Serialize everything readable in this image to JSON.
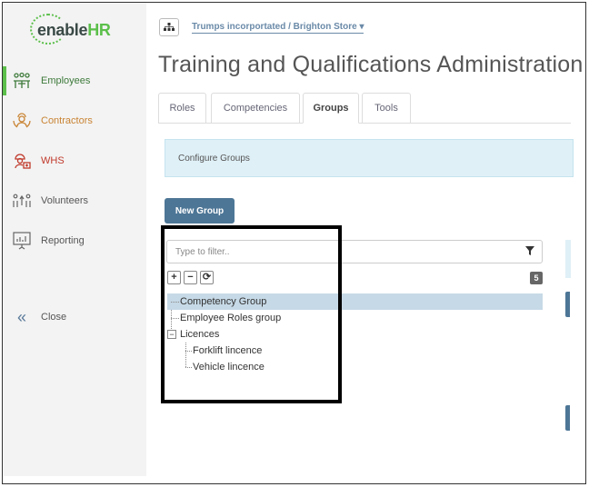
{
  "brand": {
    "part1": "enable",
    "part2": "HR"
  },
  "sidebar": {
    "items": [
      {
        "label": "Employees",
        "icon": "employees-icon",
        "color": "#3d7a3a",
        "active": true
      },
      {
        "label": "Contractors",
        "icon": "contractors-icon",
        "color": "#c98434"
      },
      {
        "label": "WHS",
        "icon": "whs-icon",
        "color": "#c0392b"
      },
      {
        "label": "Volunteers",
        "icon": "volunteers-icon",
        "color": "#555555"
      },
      {
        "label": "Reporting",
        "icon": "reporting-icon",
        "color": "#555555"
      }
    ],
    "close_label": "Close"
  },
  "breadcrumb": {
    "text": "Trumps incorportated / Brighton Store ▾"
  },
  "page": {
    "title": "Training and Qualifications Administration"
  },
  "tabs": [
    {
      "label": "Roles"
    },
    {
      "label": "Competencies"
    },
    {
      "label": "Groups",
      "active": true
    },
    {
      "label": "Tools"
    }
  ],
  "info": {
    "text": "Configure Groups"
  },
  "toolbar": {
    "new_group_label": "New Group"
  },
  "filter": {
    "placeholder": "Type to filter.."
  },
  "tree_tools": {
    "expand": "+",
    "collapse": "−",
    "refresh": "⟳"
  },
  "count": "5",
  "tree": [
    {
      "label": "Competency Group",
      "level": 0,
      "selected": true
    },
    {
      "label": "Employee Roles group",
      "level": 0
    },
    {
      "label": "Licences",
      "level": 0,
      "expanded": true,
      "expander": "−"
    },
    {
      "label": "Forklift lincence",
      "level": 1
    },
    {
      "label": "Vehicle lincence",
      "level": 1
    }
  ],
  "colors": {
    "accent": "#5bbf4a",
    "primary_button": "#4d7696",
    "info_bg": "#dff0f7",
    "selected_row": "#c6d9e6"
  }
}
